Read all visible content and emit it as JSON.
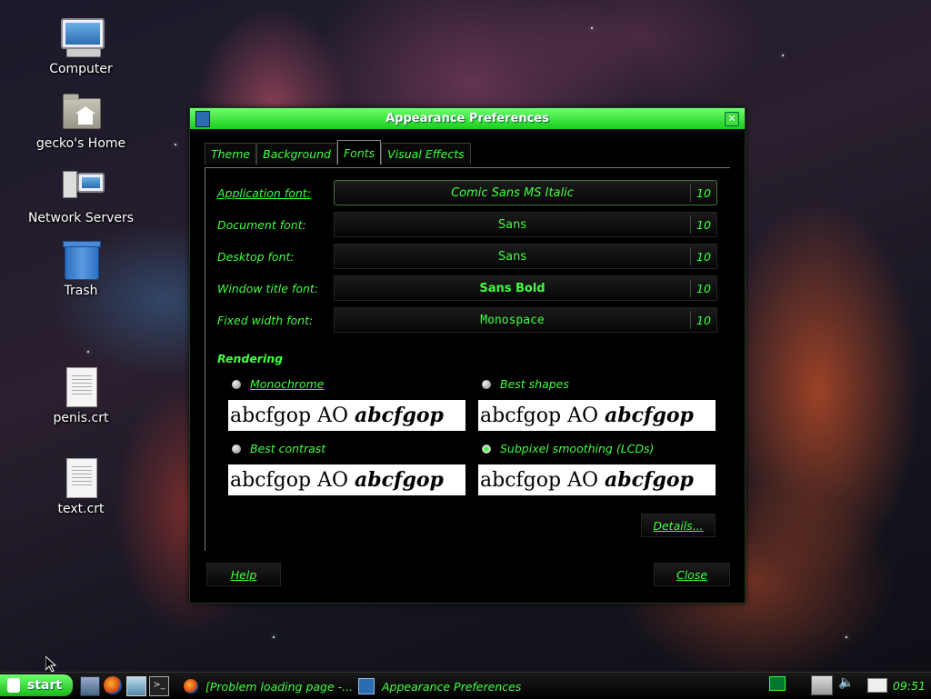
{
  "desktop": {
    "icons": [
      {
        "label": "Computer",
        "icon": "computer-icon"
      },
      {
        "label": "gecko's Home",
        "icon": "home-folder-icon"
      },
      {
        "label": "Network Servers",
        "icon": "network-servers-icon"
      },
      {
        "label": "Trash",
        "icon": "trash-icon"
      },
      {
        "label": "penis.crt",
        "icon": "document-icon"
      },
      {
        "label": "text.crt",
        "icon": "document-icon"
      }
    ]
  },
  "window": {
    "title": "Appearance Preferences",
    "tabs": [
      {
        "label": "Theme"
      },
      {
        "label": "Background"
      },
      {
        "label": "Fonts",
        "active": true
      },
      {
        "label": "Visual Effects"
      }
    ],
    "fonts": [
      {
        "label": "Application font:",
        "font": "Comic Sans MS Italic",
        "size": "10"
      },
      {
        "label": "Document font:",
        "font": "Sans",
        "size": "10"
      },
      {
        "label": "Desktop font:",
        "font": "Sans",
        "size": "10"
      },
      {
        "label": "Window title font:",
        "font": "Sans Bold",
        "size": "10"
      },
      {
        "label": "Fixed width font:",
        "font": "Monospace",
        "size": "10"
      }
    ],
    "rendering": {
      "title": "Rendering",
      "options": [
        {
          "label": "Monochrome",
          "selected": false
        },
        {
          "label": "Best shapes",
          "selected": false
        },
        {
          "label": "Best contrast",
          "selected": false
        },
        {
          "label": "Subpixel smoothing (LCDs)",
          "selected": true
        }
      ],
      "sample_regular": "abcfgop AO ",
      "sample_italic": "abcfgop"
    },
    "details_label": "Details...",
    "help_label": "Help",
    "close_label": "Close"
  },
  "taskbar": {
    "start_label": "start",
    "tasks": [
      {
        "label": "[Problem loading page -..."
      },
      {
        "label": "Appearance Preferences"
      }
    ],
    "clock": "09:51"
  },
  "colors": {
    "accent": "#3cff3c",
    "titlebar": "#2ee02e",
    "window_bg": "#000000"
  }
}
